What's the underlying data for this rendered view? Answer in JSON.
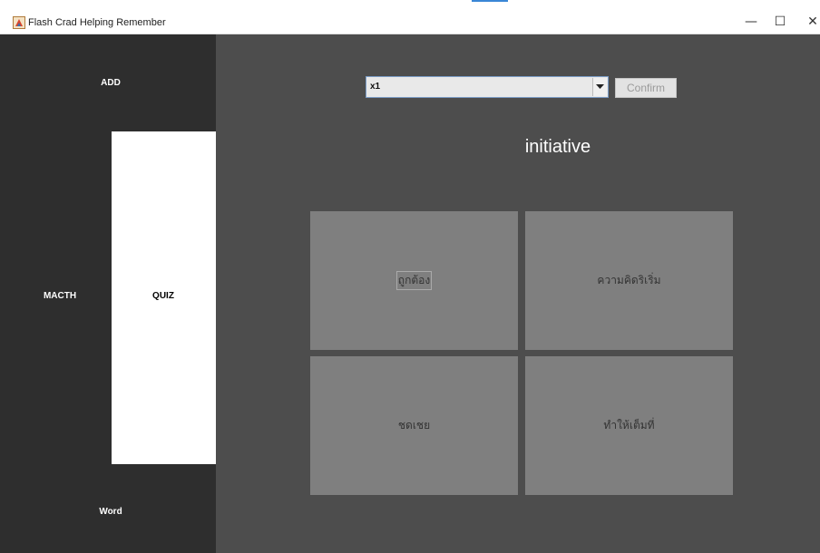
{
  "window": {
    "title": "Flash Crad Helping Remember",
    "minimize_glyph": "—",
    "maximize_glyph": "☐",
    "close_glyph": "✕",
    "app_icon": "java-app-icon"
  },
  "sidebar": {
    "items": [
      {
        "label": "ADD"
      },
      {
        "label": "MACTH"
      },
      {
        "label": "QUIZ"
      },
      {
        "label": "Word"
      }
    ],
    "selected": "QUIZ"
  },
  "quiz": {
    "deck_select": {
      "value": "x1"
    },
    "confirm_label": "Confirm",
    "word": "initiative",
    "answers": [
      {
        "label": "ถูกต้อง"
      },
      {
        "label": "ความคิดริเริ่ม"
      },
      {
        "label": "ชดเชย"
      },
      {
        "label": "ทำให้เต็มที่"
      }
    ]
  },
  "colors": {
    "sidebar_bg": "#2e2e2e",
    "main_bg": "#4d4d4d",
    "answer_bg": "#7f7f7f",
    "selected_tab_bg": "#ffffff"
  }
}
